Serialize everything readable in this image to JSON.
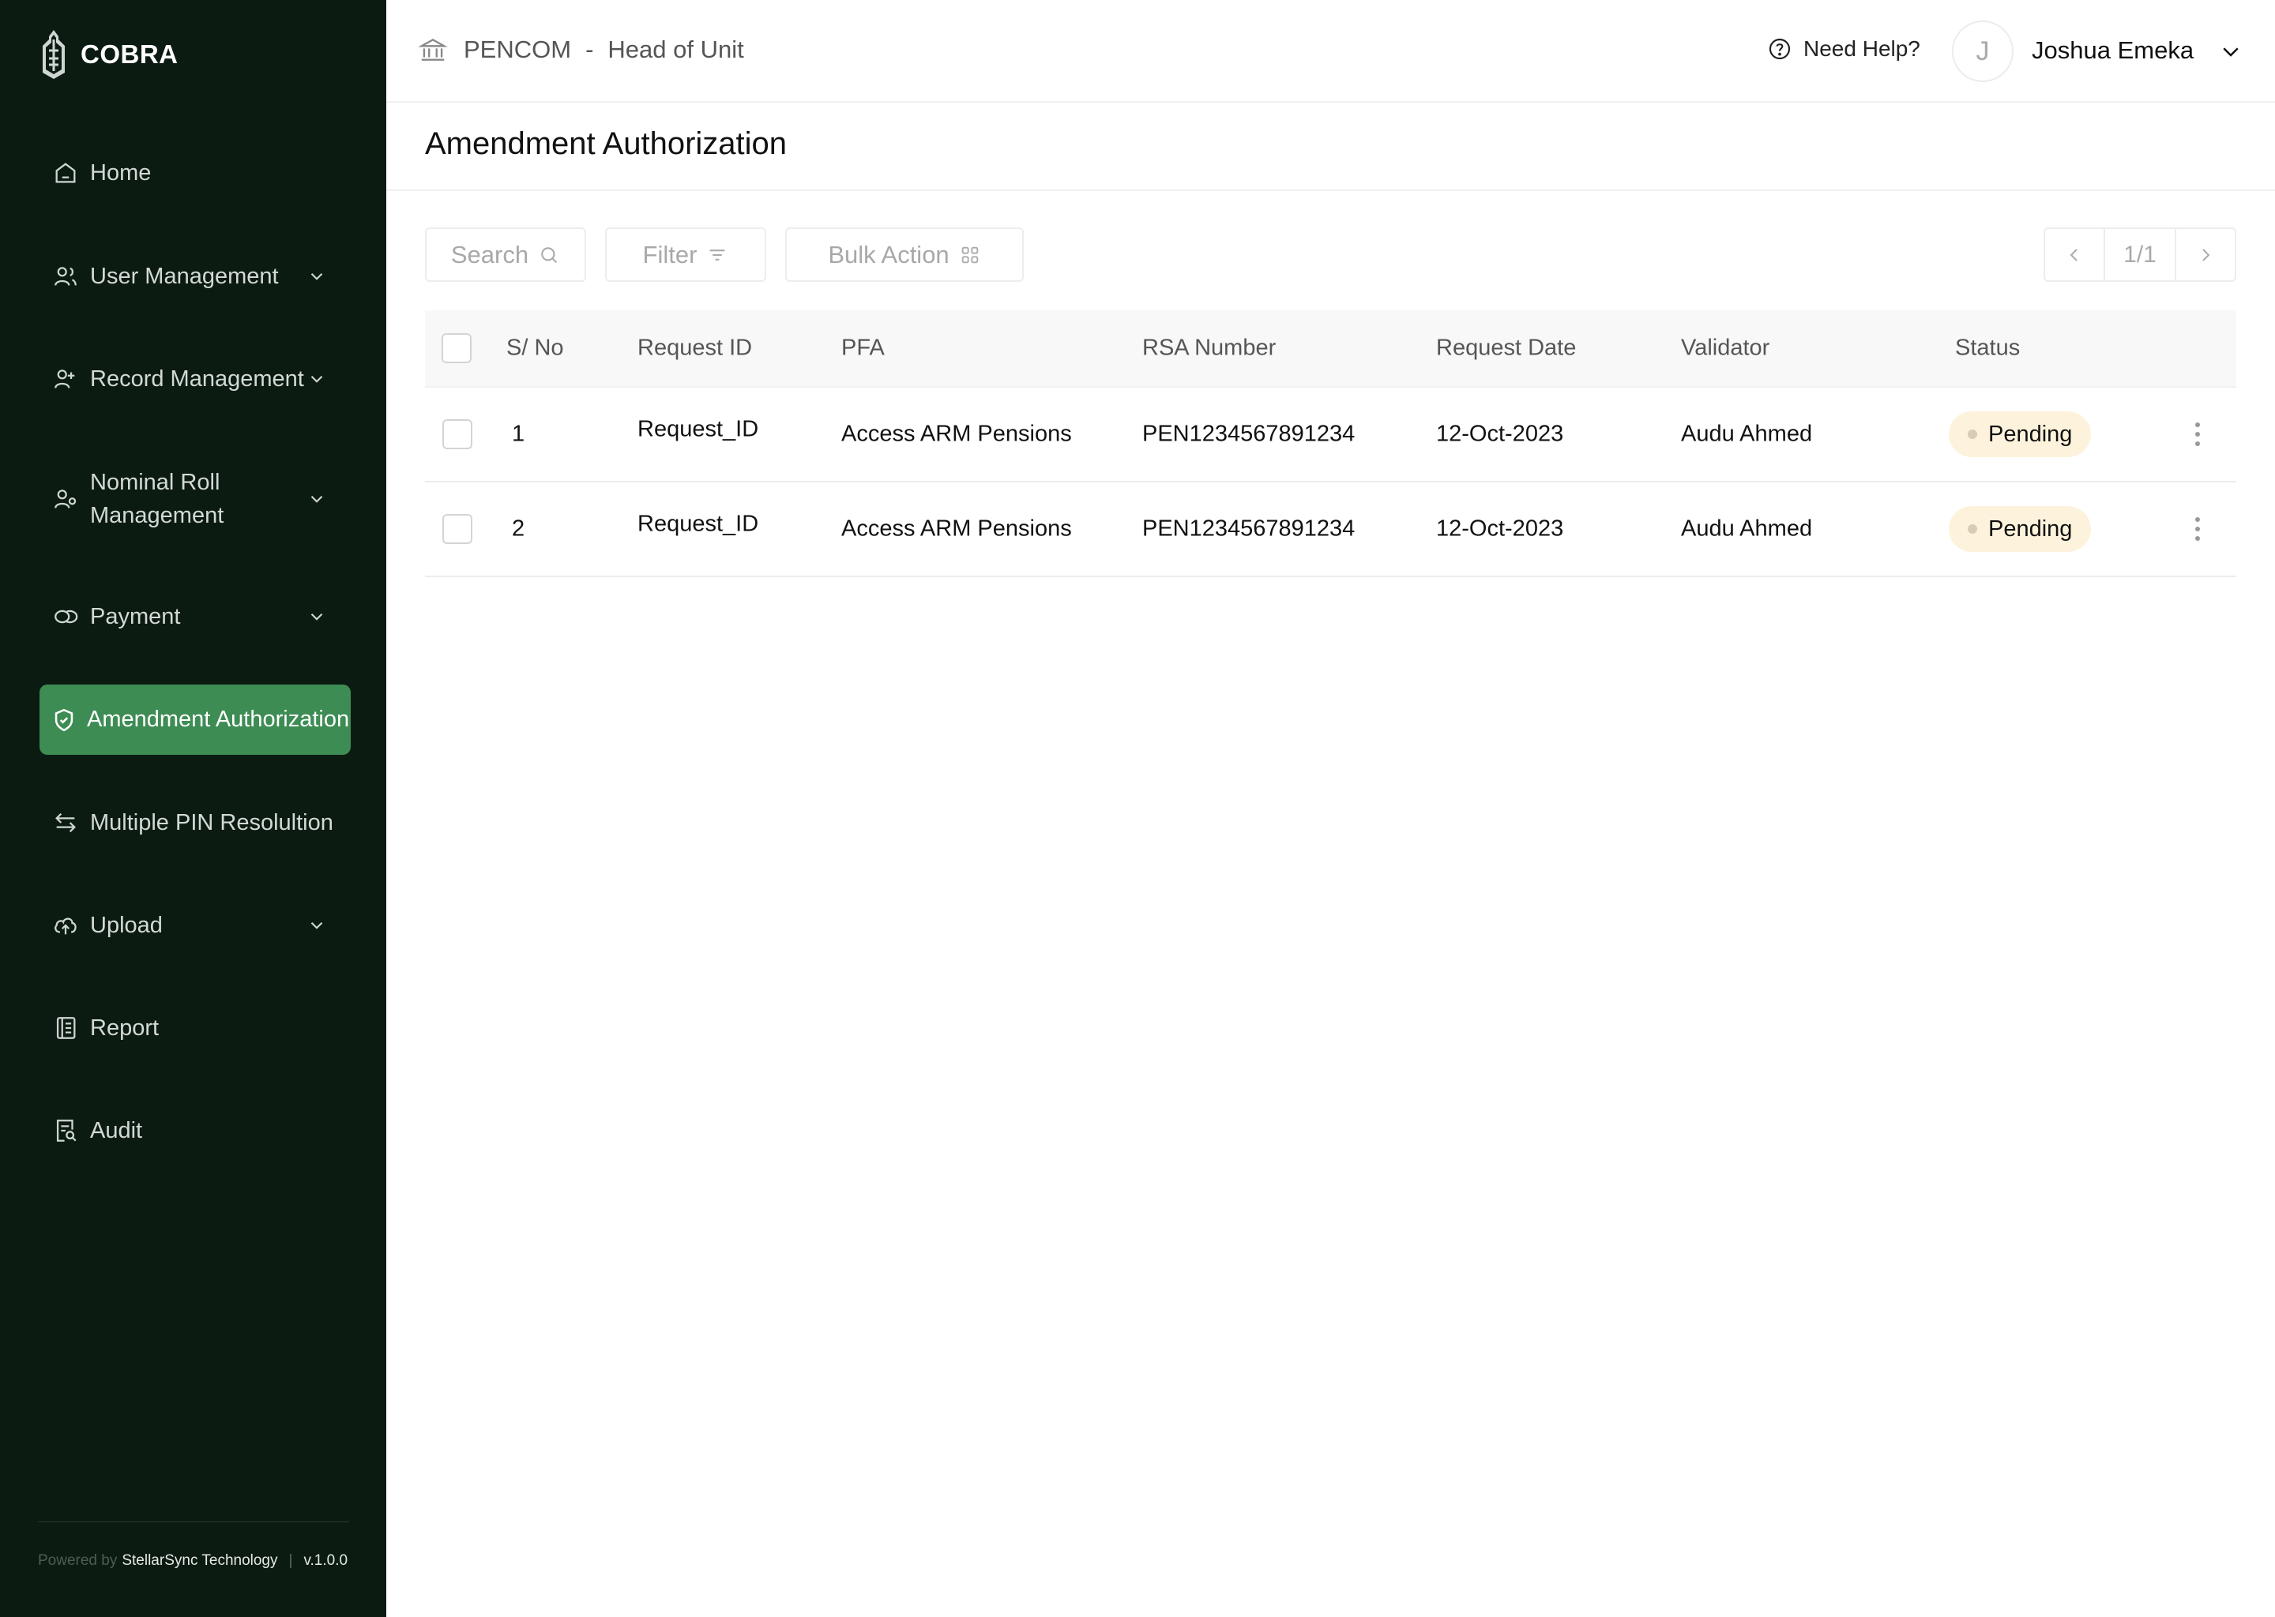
{
  "app": {
    "name": "COBRA"
  },
  "sidebar": {
    "items": [
      {
        "label": "Home"
      },
      {
        "label": "User Management"
      },
      {
        "label": "Record Management"
      },
      {
        "label": "Nominal Roll Management"
      },
      {
        "label": "Payment"
      },
      {
        "label": "Amendment Authorization"
      },
      {
        "label": "Multiple PIN Resolultion"
      },
      {
        "label": "Upload"
      },
      {
        "label": "Report"
      },
      {
        "label": "Audit"
      }
    ],
    "footer": {
      "powered": "Powered by",
      "brand": "StellarSync Technology",
      "sep": "|",
      "version": "v.1.0.0"
    }
  },
  "header": {
    "org": "PENCOM",
    "dash": "-",
    "role": "Head of Unit",
    "help": "Need Help?",
    "avatar_initial": "J",
    "user_name": "Joshua Emeka"
  },
  "page": {
    "title": "Amendment Authorization"
  },
  "toolbar": {
    "search_label": "Search",
    "filter_label": "Filter",
    "bulk_label": "Bulk Action",
    "pager": "1/1"
  },
  "table": {
    "columns": [
      "S/ No",
      "Request ID",
      "PFA",
      "RSA Number",
      "Request Date",
      "Validator",
      "Status"
    ],
    "rows": [
      {
        "sno": "1",
        "request_id": "Request_ID",
        "pfa": "Access ARM Pensions",
        "rsa": "PEN1234567891234",
        "date": "12-Oct-2023",
        "validator": "Audu Ahmed",
        "status": "Pending"
      },
      {
        "sno": "2",
        "request_id": "Request_ID",
        "pfa": "Access ARM Pensions",
        "rsa": "PEN1234567891234",
        "date": "12-Oct-2023",
        "validator": "Audu Ahmed",
        "status": "Pending"
      }
    ]
  },
  "colors": {
    "sidebar_bg": "#0c1b12",
    "active": "#3d8c53",
    "badge_bg": "#fdf3dc"
  }
}
